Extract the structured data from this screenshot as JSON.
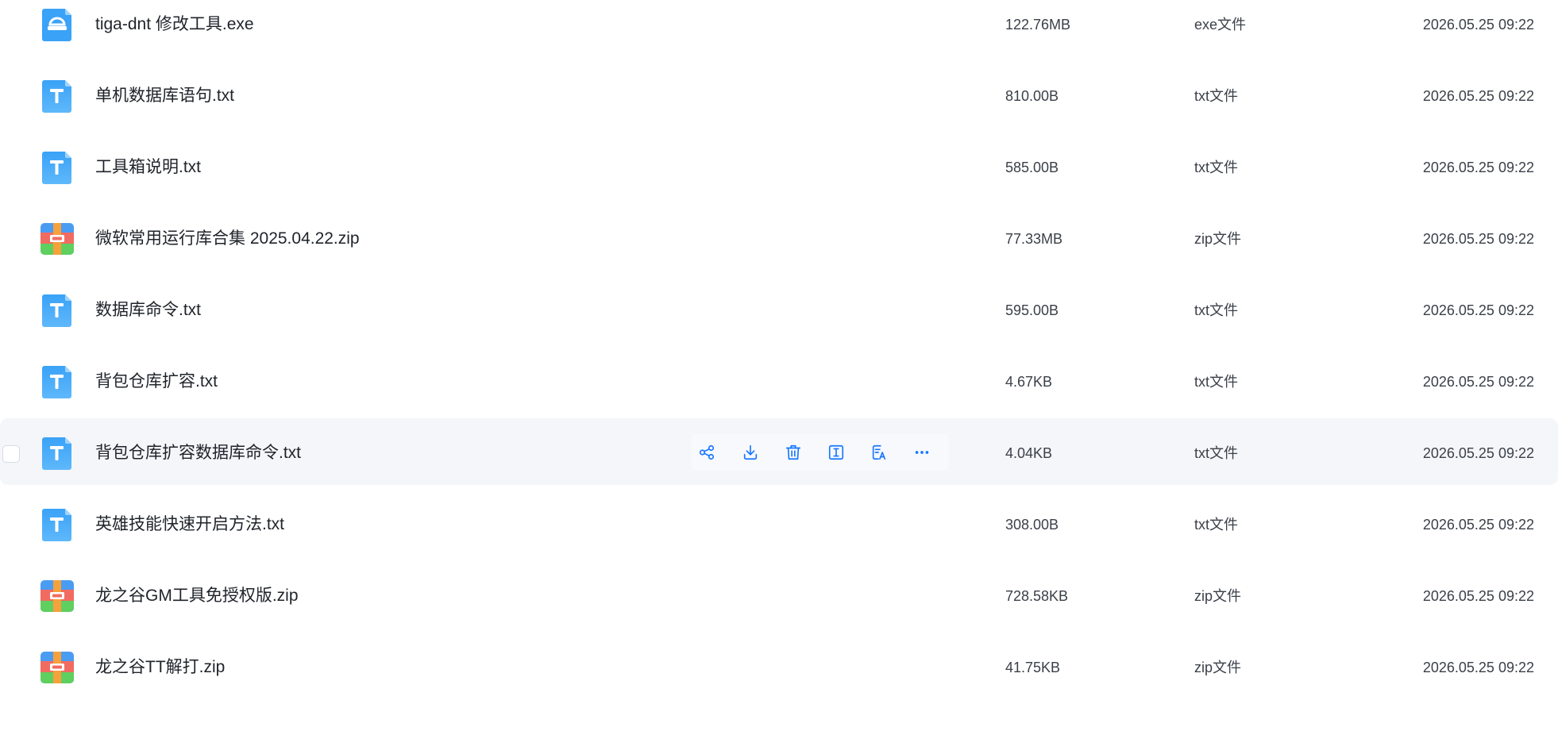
{
  "files": [
    {
      "name": "tiga-dnt 修改工具.exe",
      "size": "122.76MB",
      "type": "exe文件",
      "date": "2026.05.25 09:22",
      "icon": "exe-file-icon"
    },
    {
      "name": "单机数据库语句.txt",
      "size": "810.00B",
      "type": "txt文件",
      "date": "2026.05.25 09:22",
      "icon": "txt-file-icon"
    },
    {
      "name": "工具箱说明.txt",
      "size": "585.00B",
      "type": "txt文件",
      "date": "2026.05.25 09:22",
      "icon": "txt-file-icon"
    },
    {
      "name": "微软常用运行库合集 2025.04.22.zip",
      "size": "77.33MB",
      "type": "zip文件",
      "date": "2026.05.25 09:22",
      "icon": "zip-file-icon"
    },
    {
      "name": "数据库命令.txt",
      "size": "595.00B",
      "type": "txt文件",
      "date": "2026.05.25 09:22",
      "icon": "txt-file-icon"
    },
    {
      "name": "背包仓库扩容.txt",
      "size": "4.67KB",
      "type": "txt文件",
      "date": "2026.05.25 09:22",
      "icon": "txt-file-icon"
    },
    {
      "name": "背包仓库扩容数据库命令.txt",
      "size": "4.04KB",
      "type": "txt文件",
      "date": "2026.05.25 09:22",
      "icon": "txt-file-icon",
      "hovered": true
    },
    {
      "name": "英雄技能快速开启方法.txt",
      "size": "308.00B",
      "type": "txt文件",
      "date": "2026.05.25 09:22",
      "icon": "txt-file-icon"
    },
    {
      "name": "龙之谷GM工具免授权版.zip",
      "size": "728.58KB",
      "type": "zip文件",
      "date": "2026.05.25 09:22",
      "icon": "zip-file-icon"
    },
    {
      "name": "龙之谷TT解打.zip",
      "size": "41.75KB",
      "type": "zip文件",
      "date": "2026.05.25 09:22",
      "icon": "zip-file-icon"
    }
  ],
  "row_actions": [
    "share-icon",
    "download-icon",
    "delete-icon",
    "rename-icon",
    "translate-icon",
    "more-icon"
  ],
  "colors": {
    "accent": "#1677ff",
    "txt_icon": "#3aa2f7",
    "zip_red": "#f26b61",
    "zip_green": "#5fcf60",
    "zip_orange": "#f5a13c",
    "zip_blue": "#4a9cf2",
    "hover_row": "#f4f6fa"
  }
}
